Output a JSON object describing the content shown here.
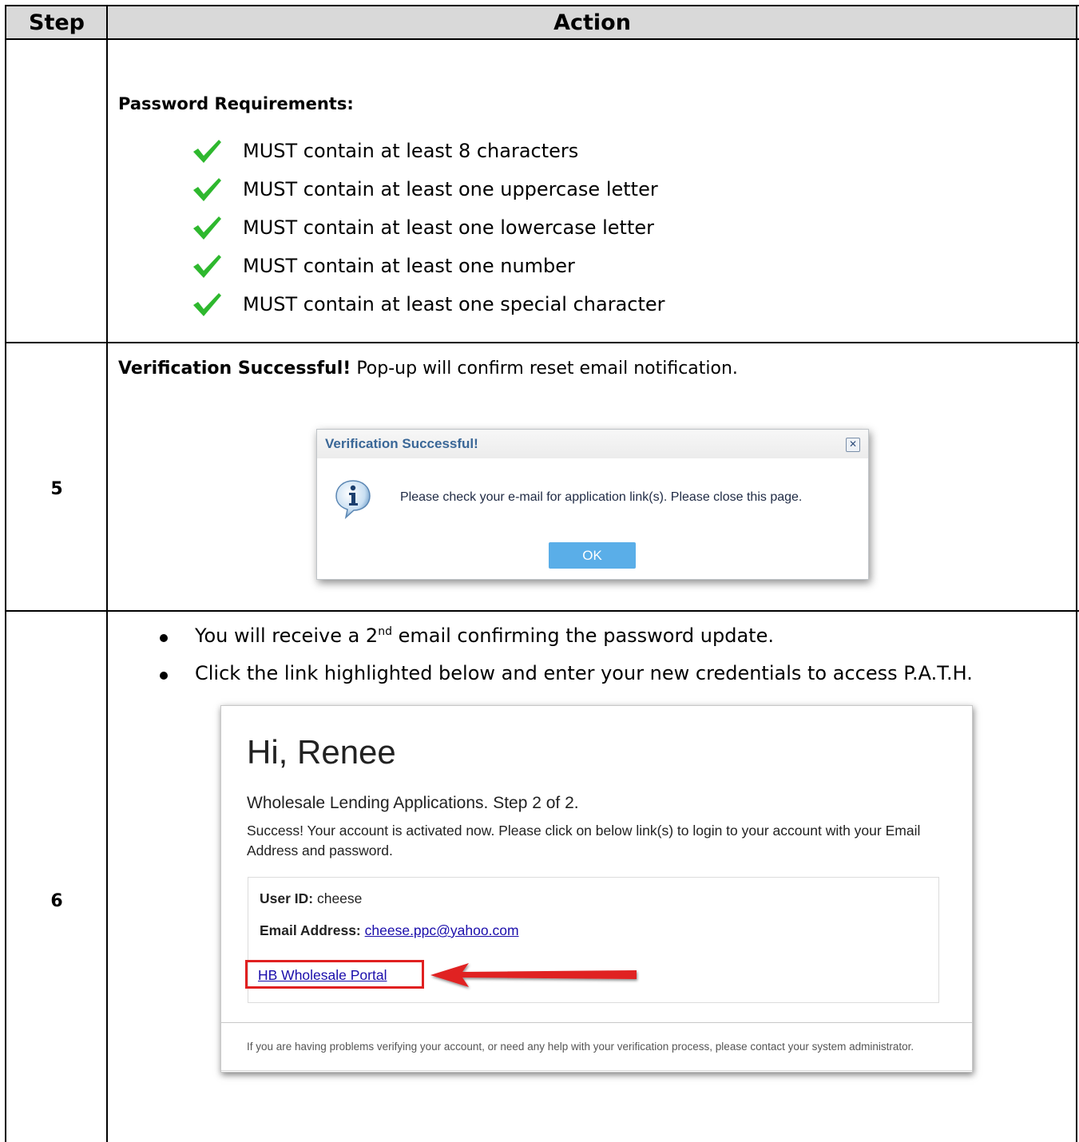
{
  "table": {
    "header": {
      "step": "Step",
      "action": "Action"
    }
  },
  "password": {
    "title": "Password Requirements:",
    "items": [
      "MUST contain at least 8 characters",
      "MUST contain at least one uppercase letter",
      "MUST contain at least one lowercase letter",
      "MUST contain at least one number",
      "MUST contain at least one special character"
    ]
  },
  "step5": {
    "number": "5",
    "intro_bold": "Verification Successful!",
    "intro_rest": " Pop-up will confirm reset email notification.",
    "popup": {
      "title": "Verification Successful!",
      "close": "✕",
      "message": "Please check your e-mail for application link(s). Please close this page.",
      "ok": "OK"
    }
  },
  "step6": {
    "number": "6",
    "bullet1_before": "You will receive a 2",
    "bullet1_sup": "nd",
    "bullet1_after": " email confirming the password update.",
    "bullet2": "Click the link highlighted below and enter your new credentials to access P.A.T.H.",
    "email": {
      "greeting": "Hi, Renee",
      "subtitle": "Wholesale Lending Applications. Step 2 of 2.",
      "body": "Success! Your account is activated now. Please click on below link(s) to login to your account with your Email Address and password.",
      "user_id_label": "User ID:",
      "user_id_value": " cheese",
      "email_label": "Email Address:",
      "email_value": "cheese.ppc@yahoo.com",
      "portal_link": "HB Wholesale Portal",
      "footer": "If you are having problems verifying your account, or need any help with your verification process, please contact your system administrator."
    }
  },
  "colors": {
    "header_bg": "#d9d9d9",
    "check": "#2eb82e",
    "link": "#1a0dab",
    "highlight": "#e02020",
    "ok_button": "#5aaee8"
  },
  "icons": {
    "check": "check-icon",
    "info": "info-icon",
    "close": "close-icon",
    "arrow": "arrow-icon"
  }
}
